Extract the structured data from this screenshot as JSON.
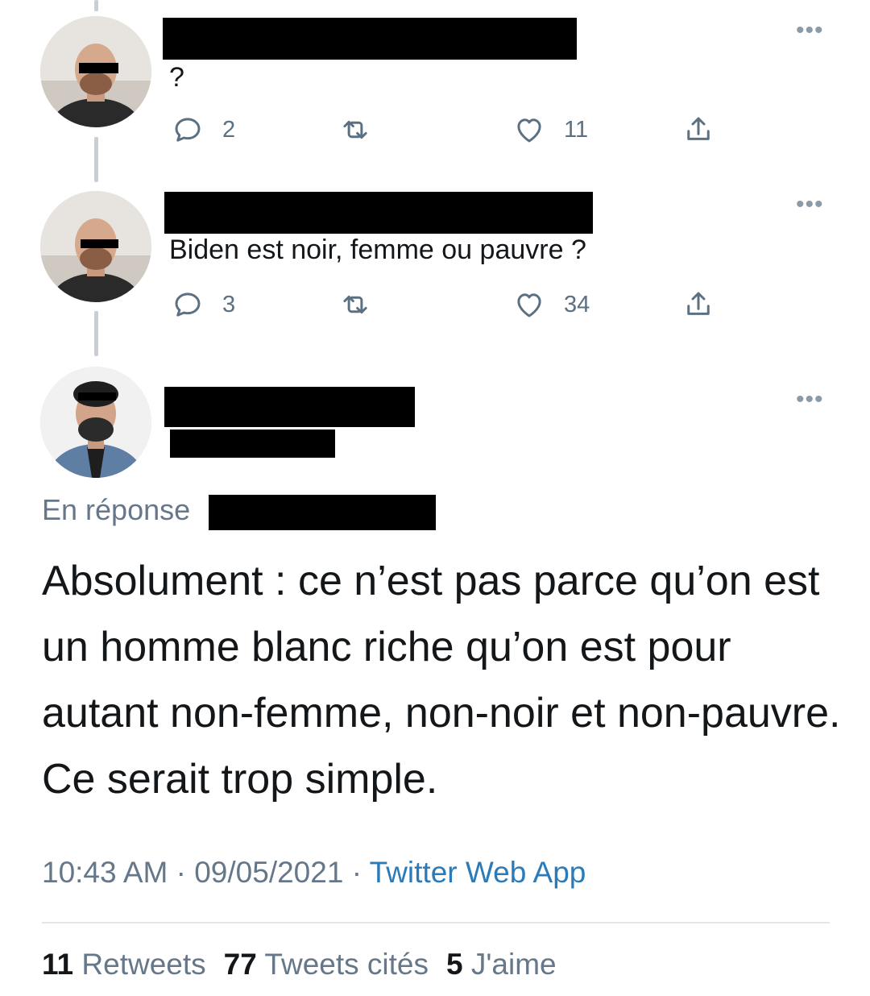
{
  "tweets": [
    {
      "text": "?",
      "reply_count": "2",
      "like_count": "11",
      "more_icon": "more-dots-icon"
    },
    {
      "text": "Biden est noir, femme ou pauvre ?",
      "reply_count": "3",
      "like_count": "34",
      "more_icon": "more-dots-icon"
    }
  ],
  "main_tweet": {
    "reply_to_label": "En réponse",
    "text": "Absolument : ce n’est pas parce qu’on est un homme blanc riche qu’on est pour autant non-femme, non-noir et non-pauvre. Ce serait trop simple.",
    "time": "10:43 AM",
    "separator": "·",
    "date": "09/05/2021",
    "source": "Twitter Web App",
    "stats": {
      "retweets_count": "11",
      "retweets_label": "Retweets",
      "quotes_count": "77",
      "quotes_label": "Tweets cités",
      "likes_count": "5",
      "likes_label": "J'aime"
    }
  },
  "icons": {
    "reply": "reply-icon",
    "retweet": "retweet-icon",
    "like": "heart-icon",
    "share": "share-icon"
  },
  "colors": {
    "secondary_text": "#66778a",
    "link": "#2b7bb9",
    "thread_line": "#c8ced3"
  }
}
